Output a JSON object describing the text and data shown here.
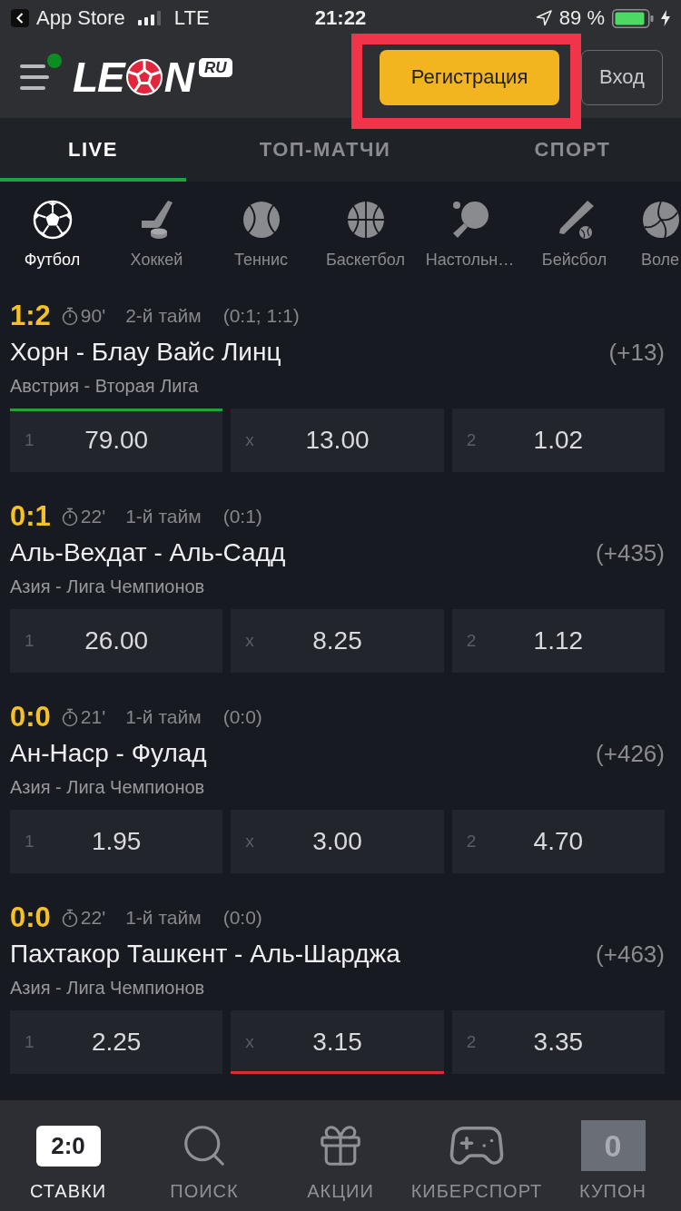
{
  "status_bar": {
    "back_label": "App Store",
    "network": "LTE",
    "time": "21:22",
    "battery": "89 %"
  },
  "header": {
    "menu_notification": true,
    "logo": {
      "before_ball": "LE",
      "after_ball": "N",
      "badge": "RU"
    },
    "register_button": "Регистрация",
    "login_button": "Вход",
    "highlight": true
  },
  "tabs": [
    {
      "label": "LIVE",
      "selected": true
    },
    {
      "label": "ТОП-МАТЧИ",
      "selected": false
    },
    {
      "label": "СПОРТ",
      "selected": false
    }
  ],
  "sports": [
    {
      "kind": "football",
      "label": "Футбол",
      "selected": true
    },
    {
      "kind": "hockey",
      "label": "Хоккей",
      "selected": false
    },
    {
      "kind": "tennis",
      "label": "Теннис",
      "selected": false
    },
    {
      "kind": "basketball",
      "label": "Баскетбол",
      "selected": false
    },
    {
      "kind": "table_tennis",
      "label": "Настольн…",
      "selected": false
    },
    {
      "kind": "baseball",
      "label": "Бейсбол",
      "selected": false
    },
    {
      "kind": "volleyball",
      "label": "Воле",
      "selected": false
    }
  ],
  "matches": [
    {
      "score": "1:2",
      "minute": "90'",
      "period": "2-й тайм",
      "period_scores": "(0:1; 1:1)",
      "teams": "Хорн - Блау Вайс Линц",
      "more": "(+13)",
      "league": "Австрия - Вторая Лига",
      "odds": [
        {
          "label": "1",
          "value": "79.00",
          "rising": true,
          "falling": false
        },
        {
          "label": "x",
          "value": "13.00",
          "rising": false,
          "falling": false
        },
        {
          "label": "2",
          "value": "1.02",
          "rising": false,
          "falling": false
        }
      ]
    },
    {
      "score": "0:1",
      "minute": "22'",
      "period": "1-й тайм",
      "period_scores": "(0:1)",
      "teams": "Аль-Вехдат - Аль-Садд",
      "more": "(+435)",
      "league": "Азия - Лига Чемпионов",
      "odds": [
        {
          "label": "1",
          "value": "26.00",
          "rising": false,
          "falling": false
        },
        {
          "label": "x",
          "value": "8.25",
          "rising": false,
          "falling": false
        },
        {
          "label": "2",
          "value": "1.12",
          "rising": false,
          "falling": false
        }
      ]
    },
    {
      "score": "0:0",
      "minute": "21'",
      "period": "1-й тайм",
      "period_scores": "(0:0)",
      "teams": "Ан-Наср - Фулад",
      "more": "(+426)",
      "league": "Азия - Лига Чемпионов",
      "odds": [
        {
          "label": "1",
          "value": "1.95",
          "rising": false,
          "falling": false
        },
        {
          "label": "x",
          "value": "3.00",
          "rising": false,
          "falling": false
        },
        {
          "label": "2",
          "value": "4.70",
          "rising": false,
          "falling": false
        }
      ]
    },
    {
      "score": "0:0",
      "minute": "22'",
      "period": "1-й тайм",
      "period_scores": "(0:0)",
      "teams": "Пахтакор Ташкент - Аль-Шарджа",
      "more": "(+463)",
      "league": "Азия - Лига Чемпионов",
      "odds": [
        {
          "label": "1",
          "value": "2.25",
          "rising": false,
          "falling": false
        },
        {
          "label": "x",
          "value": "3.15",
          "rising": false,
          "falling": true
        },
        {
          "label": "2",
          "value": "3.35",
          "rising": false,
          "falling": false
        }
      ]
    }
  ],
  "bottom_nav": [
    {
      "kind": "score",
      "badge": "2:0",
      "label": "СТАВКИ",
      "selected": true
    },
    {
      "kind": "search",
      "label": "ПОИСК",
      "selected": false
    },
    {
      "kind": "gift",
      "label": "АКЦИИ",
      "selected": false
    },
    {
      "kind": "gamepad",
      "label": "КИБЕРСПОРТ",
      "selected": false
    },
    {
      "kind": "coupon",
      "badge": "0",
      "label": "КУПОН",
      "selected": false
    }
  ]
}
